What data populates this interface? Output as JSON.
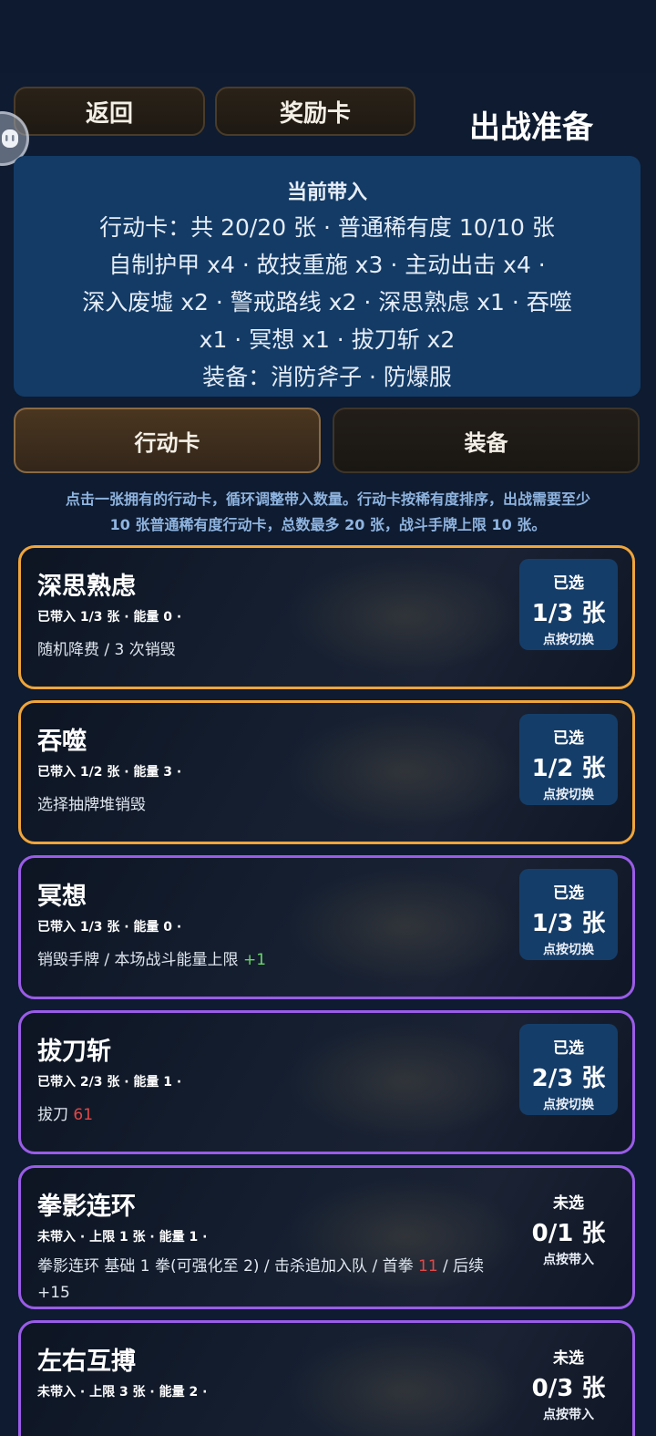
{
  "header": {
    "back_label": "返回",
    "reward_label": "奖励卡",
    "title": "出战准备"
  },
  "summary": {
    "title": "当前带入",
    "lines": [
      "行动卡：共 20/20 张 · 普通稀有度 10/10 张",
      "自制护甲 x4 · 故技重施 x3 · 主动出击 x4 ·",
      "深入废墟 x2 · 警戒路线 x2 · 深思熟虑 x1 · 吞噬",
      "x1 · 冥想 x1 · 拔刀斩 x2",
      "装备：消防斧子 · 防爆服"
    ]
  },
  "tabs": [
    {
      "label": "行动卡",
      "active": true
    },
    {
      "label": "装备",
      "active": false
    }
  ],
  "hint": {
    "line1": "点击一张拥有的行动卡，循环调整带入数量。行动卡按稀有度排序，出战需要至少",
    "line2": "10 张普通稀有度行动卡，总数最多 20 张，战斗手牌上限 10 张。"
  },
  "colors": {
    "orange_border": "#f0a53a",
    "purple_border": "#9a5ce8",
    "panel_blue": "#133b66"
  },
  "cards": [
    {
      "name": "深思熟虑",
      "meta": "已带入 1/3 张 · 能量 0 ·",
      "desc": "随机降费 / 3 次销毁",
      "status": "已选",
      "count": "1/3 张",
      "action": "点按切换",
      "rarity": "orange"
    },
    {
      "name": "吞噬",
      "meta": "已带入 1/2 张 · 能量 3 ·",
      "desc": "选择抽牌堆销毁",
      "status": "已选",
      "count": "1/2 张",
      "action": "点按切换",
      "rarity": "orange"
    },
    {
      "name": "冥想",
      "meta": "已带入 1/3 张 · 能量 0 ·",
      "desc_a": "销毁手牌 / 本场战斗能量上限 ",
      "desc_hl": "+1",
      "status": "已选",
      "count": "1/3 张",
      "action": "点按切换",
      "rarity": "purple"
    },
    {
      "name": "拔刀斩",
      "meta": "已带入 2/3 张 · 能量 1 ·",
      "desc_a": "拔刀 ",
      "desc_hl": "61",
      "status": "已选",
      "count": "2/3 张",
      "action": "点按切换",
      "rarity": "purple"
    },
    {
      "name": "拳影连环",
      "meta": "未带入 · 上限 1 张 · 能量 1 ·",
      "desc_a": "拳影连环 基础 1 拳(可强化至 2) / 击杀追加入队 / 首拳 ",
      "desc_hl": "11",
      "desc_b": " / 后续 +15",
      "status": "未选",
      "count": "0/1 张",
      "action": "点按带入",
      "rarity": "purple"
    },
    {
      "name": "左右互搏",
      "meta": "未带入 · 上限 3 张 · 能量 2 ·",
      "status": "未选",
      "count": "0/3 张",
      "action": "点按带入",
      "rarity": "purple"
    }
  ]
}
